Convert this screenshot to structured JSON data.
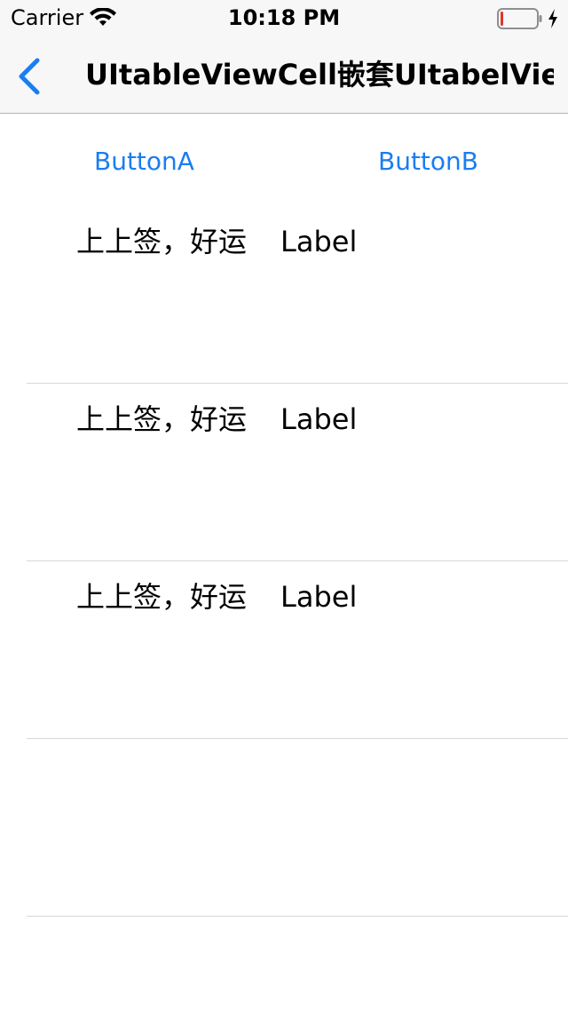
{
  "status_bar": {
    "carrier": "Carrier",
    "time": "10:18 PM",
    "icons": [
      "wifi-icon",
      "battery-icon",
      "charging-icon"
    ],
    "battery_level_fraction": 0.05,
    "battery_level_color": "#e0362b"
  },
  "nav": {
    "back_icon": "chevron-left-icon",
    "title": "UItableViewCell嵌套UItabelView",
    "accent_color": "#1a7ef0"
  },
  "buttons": {
    "a_label": "ButtonA",
    "b_label": "ButtonB"
  },
  "rows": [
    {
      "text": "上上签，好运",
      "label": "Label"
    },
    {
      "text": "上上签，好运",
      "label": "Label"
    },
    {
      "text": "上上签，好运",
      "label": "Label"
    },
    {
      "text": "",
      "label": ""
    }
  ]
}
